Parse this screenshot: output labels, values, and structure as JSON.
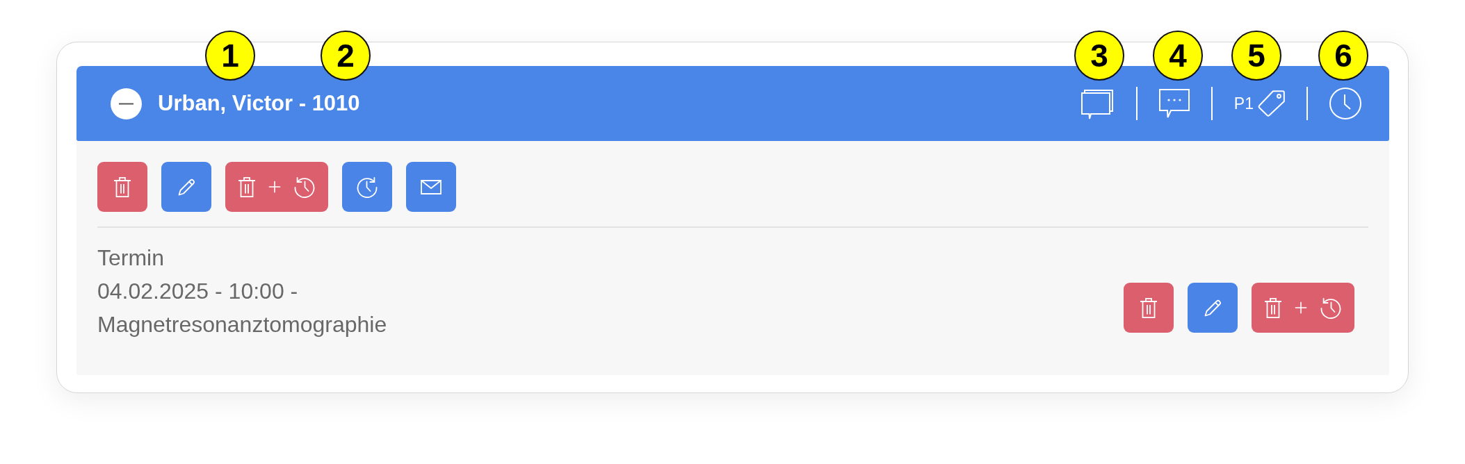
{
  "header": {
    "expanded": true,
    "title": "Urban, Victor - 1010",
    "priority": "P1"
  },
  "toolbar": [
    {
      "kind": "delete"
    },
    {
      "kind": "edit"
    },
    {
      "kind": "delete_history"
    },
    {
      "kind": "reschedule"
    },
    {
      "kind": "mail"
    }
  ],
  "appointments": [
    {
      "label": "Termin",
      "details": "04.02.2025 - 10:00 - Magnetresonanztomographie",
      "actions": [
        {
          "kind": "delete"
        },
        {
          "kind": "edit"
        },
        {
          "kind": "delete_history"
        }
      ]
    }
  ],
  "callouts": [
    {
      "label": "1"
    },
    {
      "label": "2"
    },
    {
      "label": "3"
    },
    {
      "label": "4"
    },
    {
      "label": "5"
    },
    {
      "label": "6"
    }
  ]
}
